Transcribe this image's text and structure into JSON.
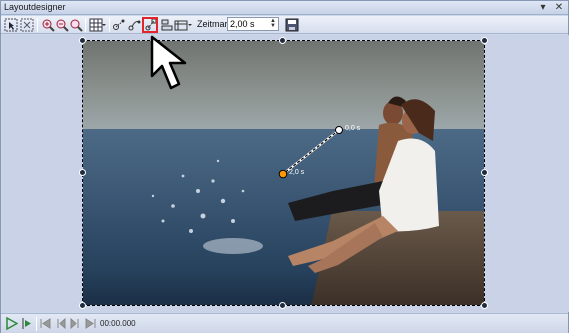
{
  "window": {
    "title": "Layoutdesigner",
    "pin_icon": "pin-icon",
    "close_icon": "close-icon"
  },
  "toolbar": {
    "tools": [
      "select-icon",
      "grid-select-icon",
      "zoom-in-icon",
      "zoom-out-icon",
      "zoom-fit-icon",
      "grid-icon",
      "grid-dropdown-icon",
      "keyframe-icon",
      "motion-path-icon",
      "highlighted-tool-icon",
      "align-icon",
      "distribute-icon",
      "dropdown-icon"
    ],
    "zeitmarke_label": "Zeitmarke:",
    "zeitmarke_value": "2,00 s",
    "save_icon": "save-icon"
  },
  "canvas": {
    "keyframe_start_label": "0,0 s",
    "keyframe_end_label": "2,0 s"
  },
  "statusbar": {
    "play_icon": "play-icon",
    "play_from_icon": "play-from-icon",
    "time": "00:00.000"
  },
  "colors": {
    "highlight": "#e4242b",
    "keyframe": "#ff9900"
  }
}
